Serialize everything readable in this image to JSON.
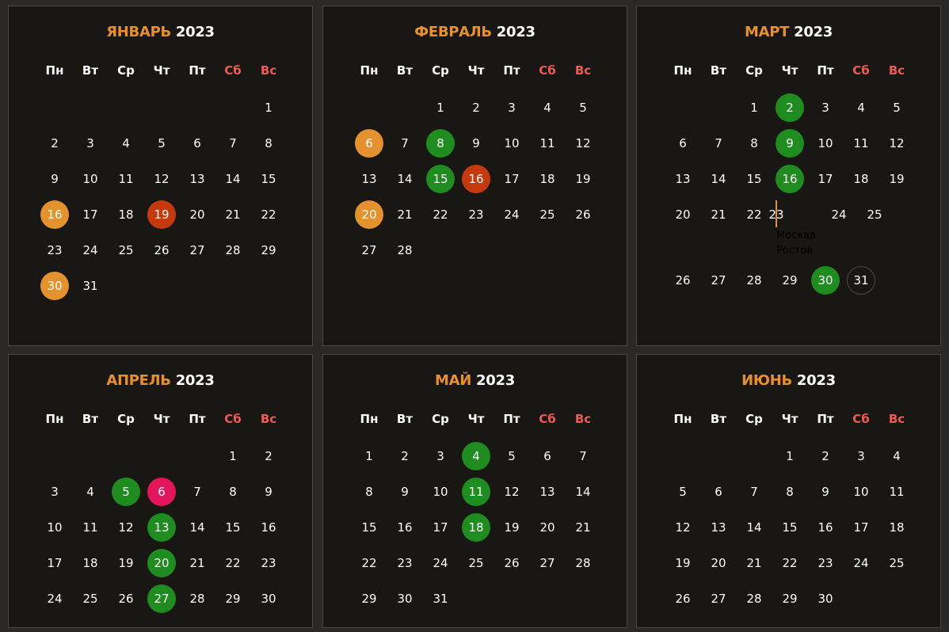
{
  "weekdays": [
    "Пн",
    "Вт",
    "Ср",
    "Чт",
    "Пт",
    "Сб",
    "Вс"
  ],
  "colors": {
    "panel_bg": "#181714",
    "page_bg": "#2a2925",
    "accent_orange": "#e4922e",
    "accent_red": "#c53a0d",
    "accent_green": "#1e8c1e",
    "accent_pink": "#e3135c",
    "weekend_text": "#f05a52"
  },
  "months": [
    {
      "name": "ЯНВАРЬ",
      "year": "2023",
      "rows": [
        [
          null,
          null,
          null,
          null,
          null,
          null,
          "1"
        ],
        [
          "2",
          "3",
          "4",
          "5",
          "6",
          "7",
          "8"
        ],
        [
          "9",
          "10",
          "11",
          "12",
          "13",
          "14",
          "15"
        ],
        [
          "16",
          "17",
          "18",
          "19",
          "20",
          "21",
          "22"
        ],
        [
          "23",
          "24",
          "25",
          "26",
          "27",
          "28",
          "29"
        ],
        [
          "30",
          "31",
          null,
          null,
          null,
          null,
          null
        ]
      ],
      "marked": {
        "16": "orange",
        "19": "red",
        "30": "orange"
      }
    },
    {
      "name": "ФЕВРАЛЬ",
      "year": "2023",
      "rows": [
        [
          null,
          null,
          "1",
          "2",
          "3",
          "4",
          "5"
        ],
        [
          "6",
          "7",
          "8",
          "9",
          "10",
          "11",
          "12"
        ],
        [
          "13",
          "14",
          "15",
          "16",
          "17",
          "18",
          "19"
        ],
        [
          "20",
          "21",
          "22",
          "23",
          "24",
          "25",
          "26"
        ],
        [
          "27",
          "28",
          null,
          null,
          null,
          null,
          null
        ]
      ],
      "marked": {
        "6": "orange",
        "8": "green",
        "15": "green",
        "16": "red",
        "20": "orange"
      }
    },
    {
      "name": "МАРТ",
      "year": "2023",
      "rows": [
        [
          null,
          null,
          "1",
          "2",
          "3",
          "4",
          "5"
        ],
        [
          "6",
          "7",
          "8",
          "9",
          "10",
          "11",
          "12"
        ],
        [
          "13",
          "14",
          "15",
          "16",
          "17",
          "18",
          "19"
        ],
        [
          "20",
          "21",
          "22",
          "23",
          "24",
          "25"
        ],
        [
          "26",
          "27",
          "28",
          "29",
          "30",
          "31",
          null
        ]
      ],
      "marked": {
        "2": "green",
        "9": "green",
        "16": "green",
        "30": "green",
        "31": "ring"
      },
      "tooltip": {
        "lines": [
          "Москва",
          "Ростов"
        ]
      }
    },
    {
      "name": "АПРЕЛЬ",
      "year": "2023",
      "rows": [
        [
          null,
          null,
          null,
          null,
          null,
          "1",
          "2"
        ],
        [
          "3",
          "4",
          "5",
          "6",
          "7",
          "8",
          "9"
        ],
        [
          "10",
          "11",
          "12",
          "13",
          "14",
          "15",
          "16"
        ],
        [
          "17",
          "18",
          "19",
          "20",
          "21",
          "22",
          "23"
        ],
        [
          "24",
          "25",
          "26",
          "27",
          "28",
          "29",
          "30"
        ]
      ],
      "marked": {
        "5": "green",
        "6": "pink",
        "13": "green",
        "20": "green",
        "27": "green"
      }
    },
    {
      "name": "МАЙ",
      "year": "2023",
      "rows": [
        [
          "1",
          "2",
          "3",
          "4",
          "5",
          "6",
          "7"
        ],
        [
          "8",
          "9",
          "10",
          "11",
          "12",
          "13",
          "14"
        ],
        [
          "15",
          "16",
          "17",
          "18",
          "19",
          "20",
          "21"
        ],
        [
          "22",
          "23",
          "24",
          "25",
          "26",
          "27",
          "28"
        ],
        [
          "29",
          "30",
          "31",
          null,
          null,
          null,
          null
        ]
      ],
      "marked": {
        "4": "green",
        "11": "green",
        "18": "green"
      }
    },
    {
      "name": "ИЮНЬ",
      "year": "2023",
      "rows": [
        [
          null,
          null,
          null,
          "1",
          "2",
          "3",
          "4"
        ],
        [
          "5",
          "6",
          "7",
          "8",
          "9",
          "10",
          "11"
        ],
        [
          "12",
          "13",
          "14",
          "15",
          "16",
          "17",
          "18"
        ],
        [
          "19",
          "20",
          "21",
          "22",
          "23",
          "24",
          "25"
        ],
        [
          "26",
          "27",
          "28",
          "29",
          "30",
          null,
          null
        ]
      ],
      "marked": {}
    }
  ]
}
